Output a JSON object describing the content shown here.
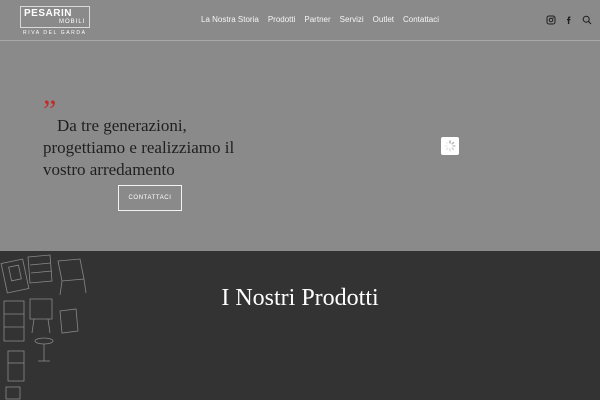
{
  "header": {
    "logo": {
      "top_text": "PESARIN",
      "bottom_text": "MOBILI",
      "sub_text": "RIVA DEL GARDA"
    },
    "nav": [
      "La Nostra Storia",
      "Prodotti",
      "Partner",
      "Servizi",
      "Outlet",
      "Contattaci"
    ],
    "icons": {
      "instagram": "instagram-icon",
      "facebook": "facebook-icon",
      "search": "search-icon"
    }
  },
  "hero": {
    "quote_mark": "”",
    "text": "Da tre generazioni, progettiamo e realizziamo il vostro arredamento",
    "button": "CONTATTACI",
    "loader_icon": "loading-spinner-icon"
  },
  "products": {
    "title": "I Nostri Prodotti",
    "sketch": "furniture-sketch-illustration"
  },
  "colors": {
    "hero_bg": "#8a8a8a",
    "section_bg": "#333333",
    "accent": "#c42a2a"
  }
}
